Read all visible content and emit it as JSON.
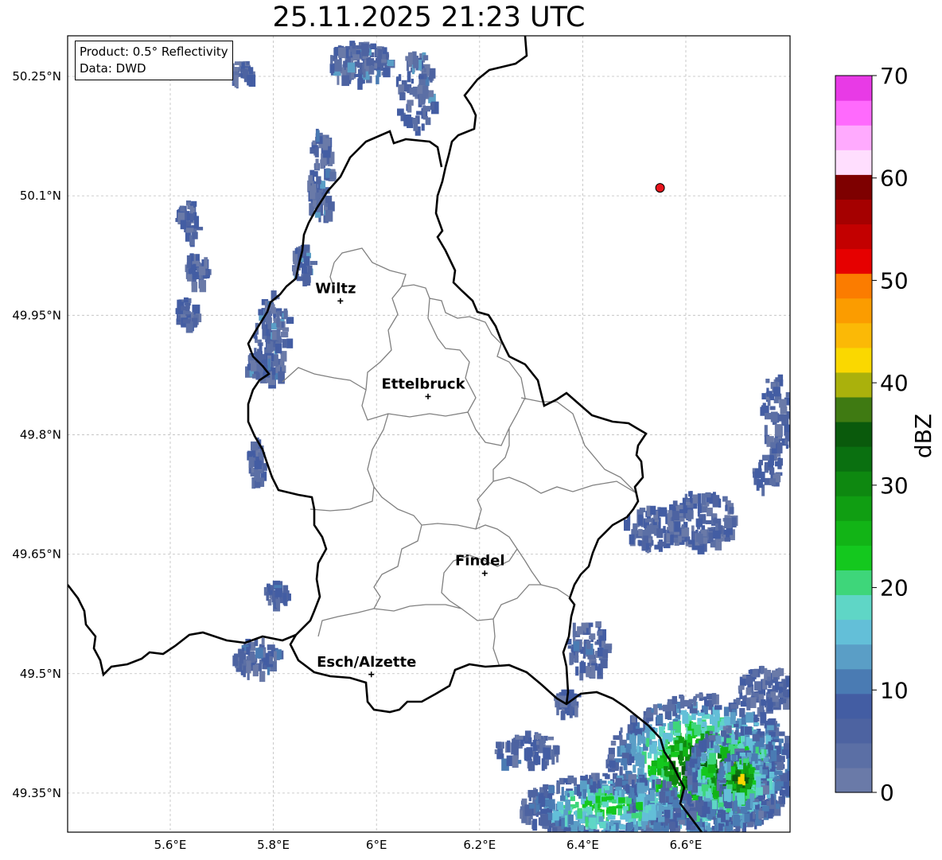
{
  "title": "25.11.2025 21:23 UTC",
  "info": {
    "product": "Product: 0.5° Reflectivity",
    "source": "Data: DWD"
  },
  "axes": {
    "lon_labels": [
      "5.6°E",
      "5.8°E",
      "6°E",
      "6.2°E",
      "6.4°E",
      "6.6°E"
    ],
    "lat_labels": [
      "50.25°N",
      "50.1°N",
      "49.95°N",
      "49.8°N",
      "49.65°N",
      "49.5°N",
      "49.35°N"
    ]
  },
  "cities": [
    {
      "name": "Wiltz",
      "lon": 5.93,
      "lat": 49.968
    },
    {
      "name": "Ettelbruck",
      "lon": 6.1,
      "lat": 49.848
    },
    {
      "name": "Findel",
      "lon": 6.21,
      "lat": 49.626
    },
    {
      "name": "Esch/Alzette",
      "lon": 5.99,
      "lat": 49.499
    }
  ],
  "marker": {
    "lon": 6.55,
    "lat": 50.11,
    "color": "#e8141c"
  },
  "colorbar": {
    "label": "dBZ",
    "ticks": [
      "0",
      "10",
      "20",
      "30",
      "40",
      "50",
      "60",
      "70"
    ],
    "min": 0,
    "max": 70,
    "colors": [
      "#6a7aa8",
      "#5b6fa5",
      "#4d63a1",
      "#435da3",
      "#4a7bb3",
      "#5a9ec6",
      "#63bfd8",
      "#5fd6c6",
      "#3ed67a",
      "#14c81e",
      "#12b416",
      "#109e12",
      "#0e8810",
      "#0a7010",
      "#0a5a0c",
      "#3f7a12",
      "#aab10c",
      "#fad800",
      "#fbb906",
      "#fb9c00",
      "#fb7c00",
      "#e60000",
      "#c30000",
      "#a50000",
      "#7e0000",
      "#ffdefe",
      "#ffaafe",
      "#ff6afd",
      "#e83ae6"
    ]
  }
}
